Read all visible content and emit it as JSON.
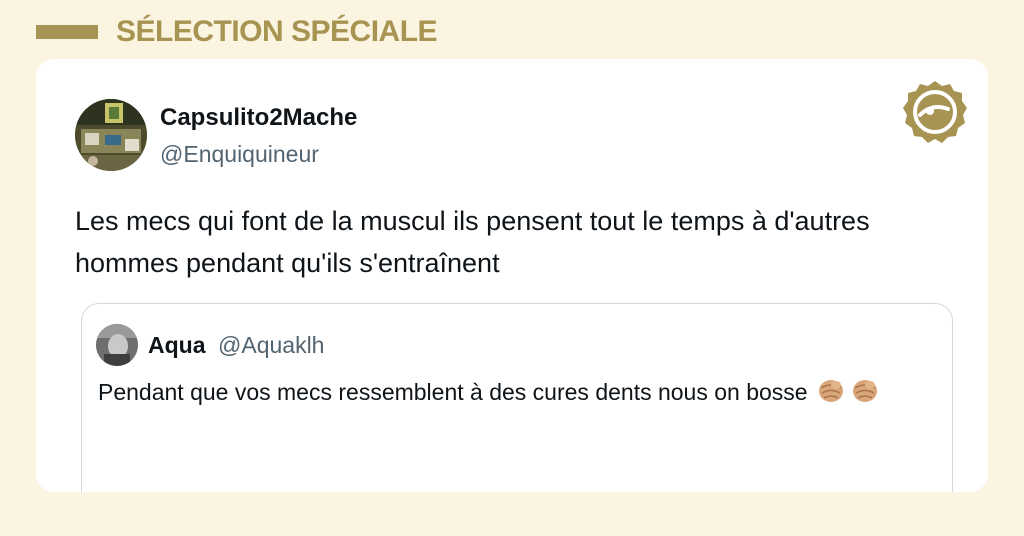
{
  "header": {
    "title": "SÉLECTION SPÉCIALE",
    "accent_color": "#a89452",
    "background_color": "#fbf4e0"
  },
  "tweet": {
    "author": {
      "display_name": "Capsulito2Mache",
      "handle": "@Enquiquineur"
    },
    "text": "Les mecs qui font de la muscul ils pensent tout le temps à d'autres hommes pendant qu'ils s'entraînent",
    "logo_icon": "brand-seal-icon"
  },
  "quoted_tweet": {
    "author": {
      "display_name": "Aqua",
      "handle": "@Aquaklh"
    },
    "text": "Pendant que vos mecs ressemblent à des cures dents nous on bosse",
    "emojis": [
      "pointing-fist-icon",
      "pointing-fist-icon"
    ]
  }
}
